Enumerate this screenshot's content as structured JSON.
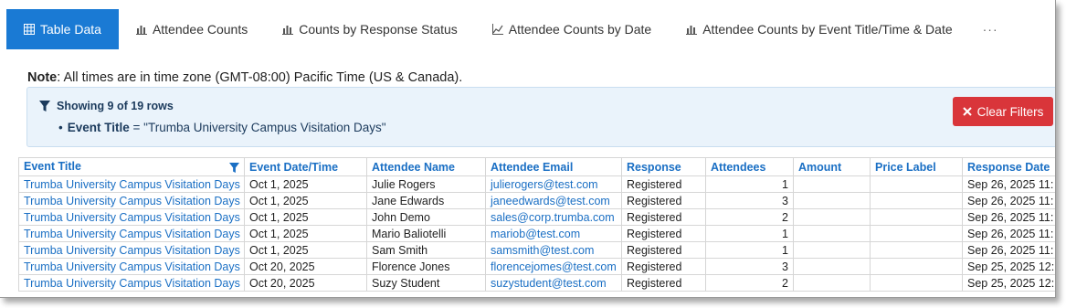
{
  "tabs": [
    {
      "label": "Table Data",
      "icon": "table-icon",
      "active": true
    },
    {
      "label": "Attendee Counts",
      "icon": "bar-chart-icon",
      "active": false
    },
    {
      "label": "Counts by Response Status",
      "icon": "bar-chart-icon",
      "active": false
    },
    {
      "label": "Attendee Counts by Date",
      "icon": "line-chart-icon",
      "active": false
    },
    {
      "label": "Attendee Counts by Event Title/Time & Date",
      "icon": "bar-chart-icon",
      "active": false
    },
    {
      "label": "···",
      "icon": "more-icon",
      "active": false
    }
  ],
  "note": {
    "label": "Note",
    "text": ": All times are in time zone (GMT-08:00) Pacific Time (US & Canada)."
  },
  "filter": {
    "showing": "Showing 9 of 19 rows",
    "bullet": "•",
    "field": "Event Title",
    "operator": " = ",
    "value": "\"Trumba University Campus Visitation Days\"",
    "clear_label": "Clear Filters"
  },
  "table": {
    "headers": [
      "Event Title",
      "Event Date/Time",
      "Attendee Name",
      "Attendee Email",
      "Response",
      "Attendees",
      "Amount",
      "Price Label",
      "Response Date"
    ],
    "rows": [
      [
        "Trumba University Campus Visitation Days",
        "Oct 1, 2025",
        "Julie Rogers",
        "julierogers@test.com",
        "Registered",
        "1",
        "",
        "",
        "Sep 26, 2025 11:"
      ],
      [
        "Trumba University Campus Visitation Days",
        "Oct 1, 2025",
        "Jane Edwards",
        "janeedwards@test.com",
        "Registered",
        "3",
        "",
        "",
        "Sep 26, 2025 11:"
      ],
      [
        "Trumba University Campus Visitation Days",
        "Oct 1, 2025",
        "John Demo",
        "sales@corp.trumba.com",
        "Registered",
        "2",
        "",
        "",
        "Sep 26, 2025 11:"
      ],
      [
        "Trumba University Campus Visitation Days",
        "Oct 1, 2025",
        "Mario Baliotelli",
        "mariob@test.com",
        "Registered",
        "1",
        "",
        "",
        "Sep 26, 2025 11:"
      ],
      [
        "Trumba University Campus Visitation Days",
        "Oct 1, 2025",
        "Sam Smith",
        "samsmith@test.com",
        "Registered",
        "1",
        "",
        "",
        "Sep 26, 2025 11:"
      ],
      [
        "Trumba University Campus Visitation Days",
        "Oct 20, 2025",
        "Florence Jones",
        "florencejomes@test.com",
        "Registered",
        "3",
        "",
        "",
        "Sep 25, 2025 12:"
      ],
      [
        "Trumba University Campus Visitation Days",
        "Oct 20, 2025",
        "Suzy Student",
        "suzystudent@test.com",
        "Registered",
        "2",
        "",
        "",
        "Sep 25, 2025 12:"
      ]
    ]
  },
  "colors": {
    "accent": "#1a7ad4",
    "link": "#1a6fc4",
    "danger": "#d9353a",
    "filter_bg": "#eaf3fb"
  }
}
